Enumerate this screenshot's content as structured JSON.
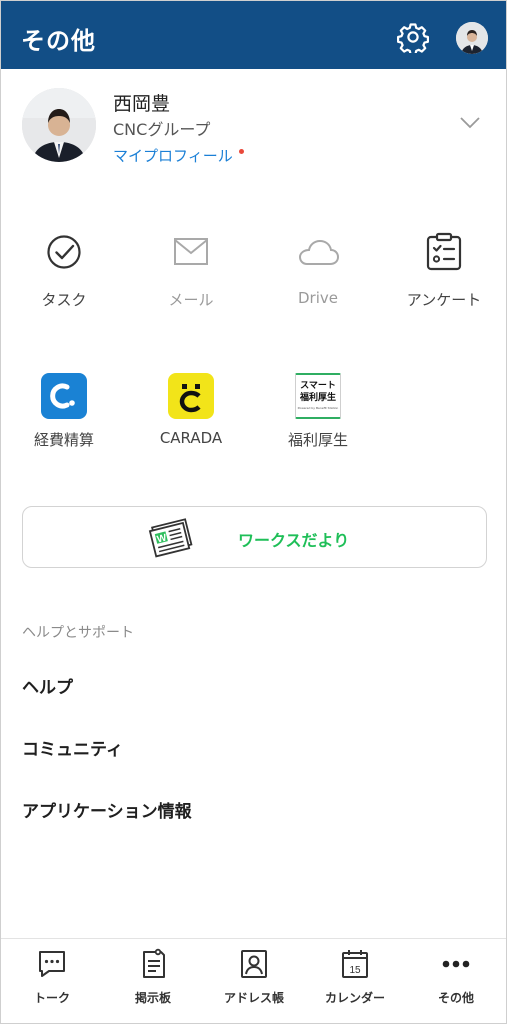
{
  "header": {
    "title": "その他",
    "colors": {
      "background": "#124e86",
      "text": "#ffffff"
    },
    "icons": [
      "gear-icon",
      "avatar"
    ]
  },
  "profile": {
    "name": "西岡豊",
    "organization": "CNCグループ",
    "link_label": "マイプロフィール",
    "link_color": "#1a7fd6",
    "notification_dot_color": "#e9483a"
  },
  "apps_row1": [
    {
      "label": "タスク",
      "icon": "task-check-icon",
      "disabled": false
    },
    {
      "label": "メール",
      "icon": "mail-icon",
      "disabled": true
    },
    {
      "label": "Drive",
      "icon": "cloud-icon",
      "disabled": true
    },
    {
      "label": "アンケート",
      "icon": "survey-clipboard-icon",
      "disabled": false
    }
  ],
  "apps_row2": [
    {
      "label": "経費精算",
      "icon": "expense-app-icon",
      "tile_color": "#1a82d4"
    },
    {
      "label": "CARADA",
      "icon": "carada-app-icon",
      "tile_color": "#f2e419"
    },
    {
      "label": "福利厚生",
      "icon": "welfare-app-icon",
      "tile_lines": [
        "スマート",
        "福利厚生"
      ],
      "tile_caption": "Powered by Benefit Station"
    }
  ],
  "works_banner": {
    "label": "ワークスだより",
    "icon": "newspaper-icon",
    "color": "#1fbf58"
  },
  "help_section": {
    "title": "ヘルプとサポート",
    "items": [
      "ヘルプ",
      "コミュニティ",
      "アプリケーション情報"
    ]
  },
  "bottom_nav": [
    {
      "label": "トーク",
      "icon": "chat-bubble-icon"
    },
    {
      "label": "掲示板",
      "icon": "board-icon"
    },
    {
      "label": "アドレス帳",
      "icon": "address-book-icon"
    },
    {
      "label": "カレンダー",
      "icon": "calendar-icon",
      "calendar_day": "15"
    },
    {
      "label": "その他",
      "icon": "more-dots-icon",
      "active": true
    }
  ]
}
